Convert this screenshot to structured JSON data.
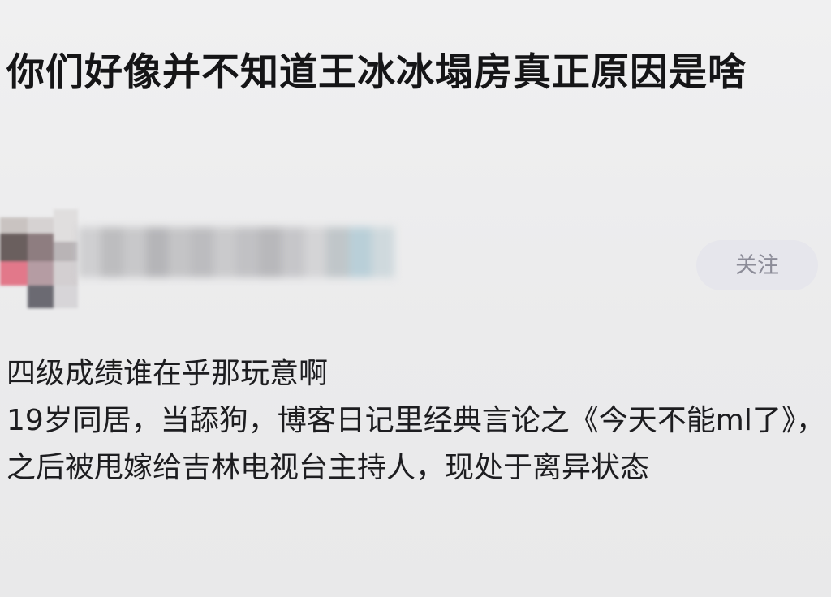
{
  "post": {
    "title": "你们好像并不知道王冰冰塌房真正原因是啥",
    "follow_label": "关注",
    "content_line_1": "四级成绩谁在乎那玩意啊",
    "content_line_2": "19岁同居，当舔狗，博客日记里经典言论之《今天不能ml了》，之后被甩嫁给吉林电视台主持人，现处于离异状态"
  },
  "colors": {
    "background": "#ededee",
    "title_text": "#151517",
    "follow_button_bg": "#e6e6ec",
    "follow_button_text": "#8c8c98"
  }
}
